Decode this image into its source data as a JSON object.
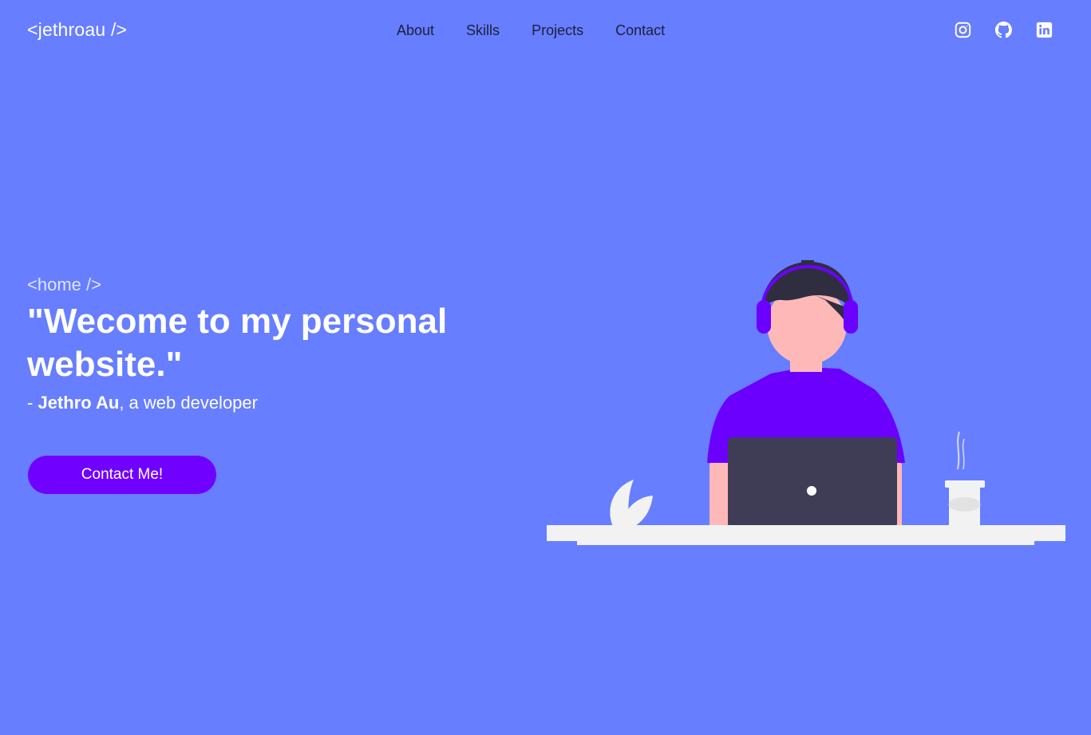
{
  "header": {
    "logo": "<jethroau />",
    "nav": [
      "About",
      "Skills",
      "Projects",
      "Contact"
    ],
    "socials": [
      "instagram-icon",
      "github-icon",
      "linkedin-icon"
    ]
  },
  "hero": {
    "tag": "<home />",
    "headline": "\"Wecome to my personal website.\"",
    "byline_prefix": "- ",
    "byline_name": "Jethro Au",
    "byline_suffix": ", a web developer",
    "cta": "Contact Me!"
  },
  "colors": {
    "background": "#667eff",
    "accent": "#7000ff",
    "text": "#ffffff",
    "nav_text": "#1d1f3a"
  }
}
